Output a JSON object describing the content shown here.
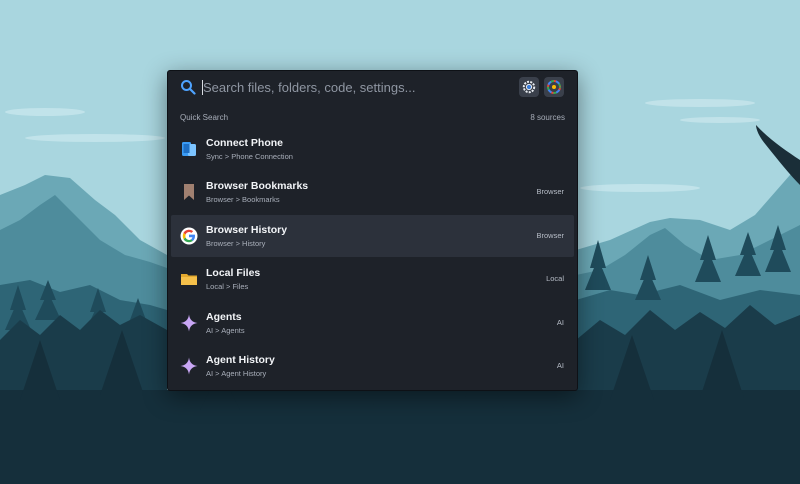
{
  "search": {
    "placeholder": "Search files, folders, code, settings...",
    "value": ""
  },
  "toolbar": {
    "settings_icon": "gear-icon",
    "extras_icon": "color-wheel-icon"
  },
  "section": {
    "title": "Quick Search",
    "count": "8 sources"
  },
  "results": [
    {
      "title": "Connect Phone",
      "path": "Sync > Phone Connection",
      "tag": "",
      "icon": "phone-sync-icon",
      "selected": false
    },
    {
      "title": "Browser Bookmarks",
      "path": "Browser > Bookmarks",
      "tag": "Browser",
      "icon": "bookmark-icon",
      "selected": false
    },
    {
      "title": "Browser History",
      "path": "Browser > History",
      "tag": "Browser",
      "icon": "google-icon",
      "selected": true
    },
    {
      "title": "Local Files",
      "path": "Local > Files",
      "tag": "Local",
      "icon": "folder-icon",
      "selected": false
    },
    {
      "title": "Agents",
      "path": "AI > Agents",
      "tag": "AI",
      "icon": "sparkle-icon",
      "selected": false
    },
    {
      "title": "Agent History",
      "path": "AI > Agent History",
      "tag": "AI",
      "icon": "sparkle-icon",
      "selected": false
    }
  ],
  "colors": {
    "panel_bg": "#1e2229",
    "selected_row": "#2c313b",
    "search_accent": "#4ea3ff",
    "sparkle": "#c9a7f5",
    "folder": "#f5c04a",
    "bookmark": "#a08070"
  }
}
